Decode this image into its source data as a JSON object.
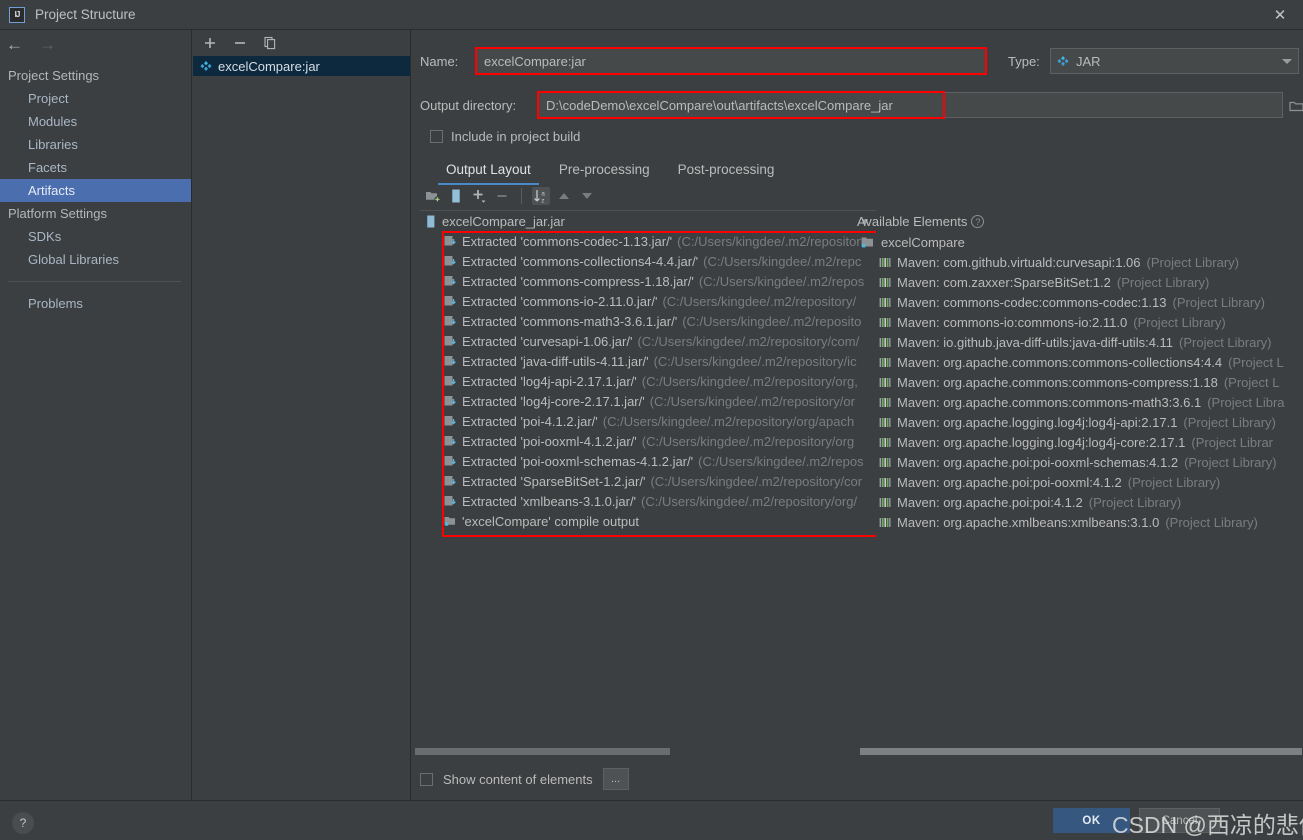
{
  "window": {
    "title": "Project Structure",
    "logo_text": "IJ",
    "close_label": "✕"
  },
  "sidebar": {
    "nav": {
      "back": "←",
      "forward": "→"
    },
    "groups": [
      {
        "label": "Project Settings",
        "items": [
          {
            "label": "Project",
            "selected": false
          },
          {
            "label": "Modules",
            "selected": false
          },
          {
            "label": "Libraries",
            "selected": false
          },
          {
            "label": "Facets",
            "selected": false
          },
          {
            "label": "Artifacts",
            "selected": true
          }
        ]
      },
      {
        "label": "Platform Settings",
        "items": [
          {
            "label": "SDKs",
            "selected": false
          },
          {
            "label": "Global Libraries",
            "selected": false
          }
        ]
      }
    ],
    "problems": "Problems"
  },
  "artifacts_panel": {
    "toolbar": [
      {
        "name": "add-artifact-button",
        "glyph": "+"
      },
      {
        "name": "remove-artifact-button",
        "glyph": "−"
      },
      {
        "name": "copy-artifact-button",
        "glyph": "copy-icon"
      }
    ],
    "items": [
      {
        "label": "excelCompare:jar",
        "selected": true
      }
    ]
  },
  "form": {
    "name_label": "Name:",
    "name_value": "excelCompare:jar",
    "type_label": "Type:",
    "type_value": "JAR",
    "output_dir_label": "Output directory:",
    "output_dir_value": "D:\\codeDemo\\excelCompare\\out\\artifacts\\excelCompare_jar",
    "include_build_label": "Include in project build",
    "include_build_checked": false
  },
  "tabs": [
    {
      "label": "Output Layout",
      "active": true
    },
    {
      "label": "Pre-processing",
      "active": false
    },
    {
      "label": "Post-processing",
      "active": false
    }
  ],
  "panel_toolbar": [
    {
      "name": "create-directory-button",
      "glyph": "folder-add-icon",
      "active": false
    },
    {
      "name": "create-archive-button",
      "glyph": "archive-icon",
      "active": false
    },
    {
      "name": "add-copy-of-button",
      "glyph": "plus-dropdown-icon",
      "active": false
    },
    {
      "name": "remove-element-button",
      "glyph": "minus-icon",
      "active": false
    },
    {
      "name": "sort-button",
      "glyph": "sort-az-icon",
      "active": true
    },
    {
      "name": "move-up-button",
      "glyph": "arrow-up-icon",
      "active": false
    },
    {
      "name": "move-down-button",
      "glyph": "arrow-down-icon",
      "active": false
    }
  ],
  "output_tree": {
    "root": {
      "label": "excelCompare_jar.jar",
      "icon": "archive-icon"
    },
    "items": [
      {
        "icon": "extracted-icon",
        "label": "Extracted 'commons-codec-1.13.jar/'",
        "path": "(C:/Users/kingdee/.m2/repositor"
      },
      {
        "icon": "extracted-icon",
        "label": "Extracted 'commons-collections4-4.4.jar/'",
        "path": "(C:/Users/kingdee/.m2/repc"
      },
      {
        "icon": "extracted-icon",
        "label": "Extracted 'commons-compress-1.18.jar/'",
        "path": "(C:/Users/kingdee/.m2/repos"
      },
      {
        "icon": "extracted-icon",
        "label": "Extracted 'commons-io-2.11.0.jar/'",
        "path": "(C:/Users/kingdee/.m2/repository/"
      },
      {
        "icon": "extracted-icon",
        "label": "Extracted 'commons-math3-3.6.1.jar/'",
        "path": "(C:/Users/kingdee/.m2/reposito"
      },
      {
        "icon": "extracted-icon",
        "label": "Extracted 'curvesapi-1.06.jar/'",
        "path": "(C:/Users/kingdee/.m2/repository/com/"
      },
      {
        "icon": "extracted-icon",
        "label": "Extracted 'java-diff-utils-4.11.jar/'",
        "path": "(C:/Users/kingdee/.m2/repository/ic"
      },
      {
        "icon": "extracted-icon",
        "label": "Extracted 'log4j-api-2.17.1.jar/'",
        "path": "(C:/Users/kingdee/.m2/repository/org,"
      },
      {
        "icon": "extracted-icon",
        "label": "Extracted 'log4j-core-2.17.1.jar/'",
        "path": "(C:/Users/kingdee/.m2/repository/or"
      },
      {
        "icon": "extracted-icon",
        "label": "Extracted 'poi-4.1.2.jar/'",
        "path": "(C:/Users/kingdee/.m2/repository/org/apach"
      },
      {
        "icon": "extracted-icon",
        "label": "Extracted 'poi-ooxml-4.1.2.jar/'",
        "path": "(C:/Users/kingdee/.m2/repository/org"
      },
      {
        "icon": "extracted-icon",
        "label": "Extracted 'poi-ooxml-schemas-4.1.2.jar/'",
        "path": "(C:/Users/kingdee/.m2/repos"
      },
      {
        "icon": "extracted-icon",
        "label": "Extracted 'SparseBitSet-1.2.jar/'",
        "path": "(C:/Users/kingdee/.m2/repository/cor"
      },
      {
        "icon": "extracted-icon",
        "label": "Extracted 'xmlbeans-3.1.0.jar/'",
        "path": "(C:/Users/kingdee/.m2/repository/org/"
      },
      {
        "icon": "compile-output-icon",
        "label": "'excelCompare' compile output",
        "path": ""
      }
    ]
  },
  "available_elements": {
    "title": "Available Elements",
    "help_glyph": "?",
    "root": {
      "label": "excelCompare",
      "icon": "module-icon"
    },
    "items": [
      {
        "label": "Maven: com.github.virtuald:curvesapi:1.06",
        "note": "(Project Library)"
      },
      {
        "label": "Maven: com.zaxxer:SparseBitSet:1.2",
        "note": "(Project Library)"
      },
      {
        "label": "Maven: commons-codec:commons-codec:1.13",
        "note": "(Project Library)"
      },
      {
        "label": "Maven: commons-io:commons-io:2.11.0",
        "note": "(Project Library)"
      },
      {
        "label": "Maven: io.github.java-diff-utils:java-diff-utils:4.11",
        "note": "(Project Library)"
      },
      {
        "label": "Maven: org.apache.commons:commons-collections4:4.4",
        "note": "(Project L"
      },
      {
        "label": "Maven: org.apache.commons:commons-compress:1.18",
        "note": "(Project L"
      },
      {
        "label": "Maven: org.apache.commons:commons-math3:3.6.1",
        "note": "(Project Libra"
      },
      {
        "label": "Maven: org.apache.logging.log4j:log4j-api:2.17.1",
        "note": "(Project Library)"
      },
      {
        "label": "Maven: org.apache.logging.log4j:log4j-core:2.17.1",
        "note": "(Project Librar"
      },
      {
        "label": "Maven: org.apache.poi:poi-ooxml-schemas:4.1.2",
        "note": "(Project Library)"
      },
      {
        "label": "Maven: org.apache.poi:poi-ooxml:4.1.2",
        "note": "(Project Library)"
      },
      {
        "label": "Maven: org.apache.poi:poi:4.1.2",
        "note": "(Project Library)"
      },
      {
        "label": "Maven: org.apache.xmlbeans:xmlbeans:3.1.0",
        "note": "(Project Library)"
      }
    ]
  },
  "footer": {
    "show_content_label": "Show content of elements",
    "show_content_checked": false,
    "dots_label": "...",
    "help_label": "?",
    "ok_label": "OK",
    "cancel_label": "Cancel",
    "watermark": "CSDN @西凉的悲伤"
  },
  "colors": {
    "background": "#3c3f41",
    "selection_blue": "#4b6eaf",
    "accent_blue": "#4a88c7",
    "ok_button": "#365880",
    "highlight_red": "#ff0000",
    "list_selected": "#0d293e"
  }
}
